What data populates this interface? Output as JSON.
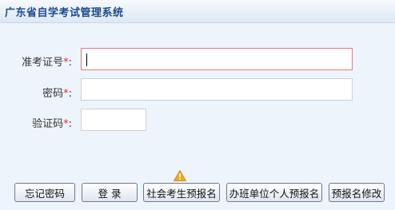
{
  "window": {
    "title": "广东省自学考试管理系统"
  },
  "form": {
    "admission_label": "准考证号",
    "password_label": "密码",
    "captcha_label": "验证码",
    "required_mark": "*",
    "colon": ":",
    "admission_value": "",
    "password_value": "",
    "captcha_value": ""
  },
  "buttons": {
    "forgot_password": "忘记密码",
    "login": "登 录",
    "social_preregister": "社会考生预报名",
    "org_preregister": "办班单位个人预报名",
    "modify_preregister": "预报名修改"
  },
  "colors": {
    "title_text": "#1c4b8c",
    "panel_bg": "#eef4fb",
    "required": "#dd3333",
    "active_border": "#e87a7a",
    "warning": "#f0a81c"
  },
  "icons": {
    "warning": "warning-icon"
  }
}
